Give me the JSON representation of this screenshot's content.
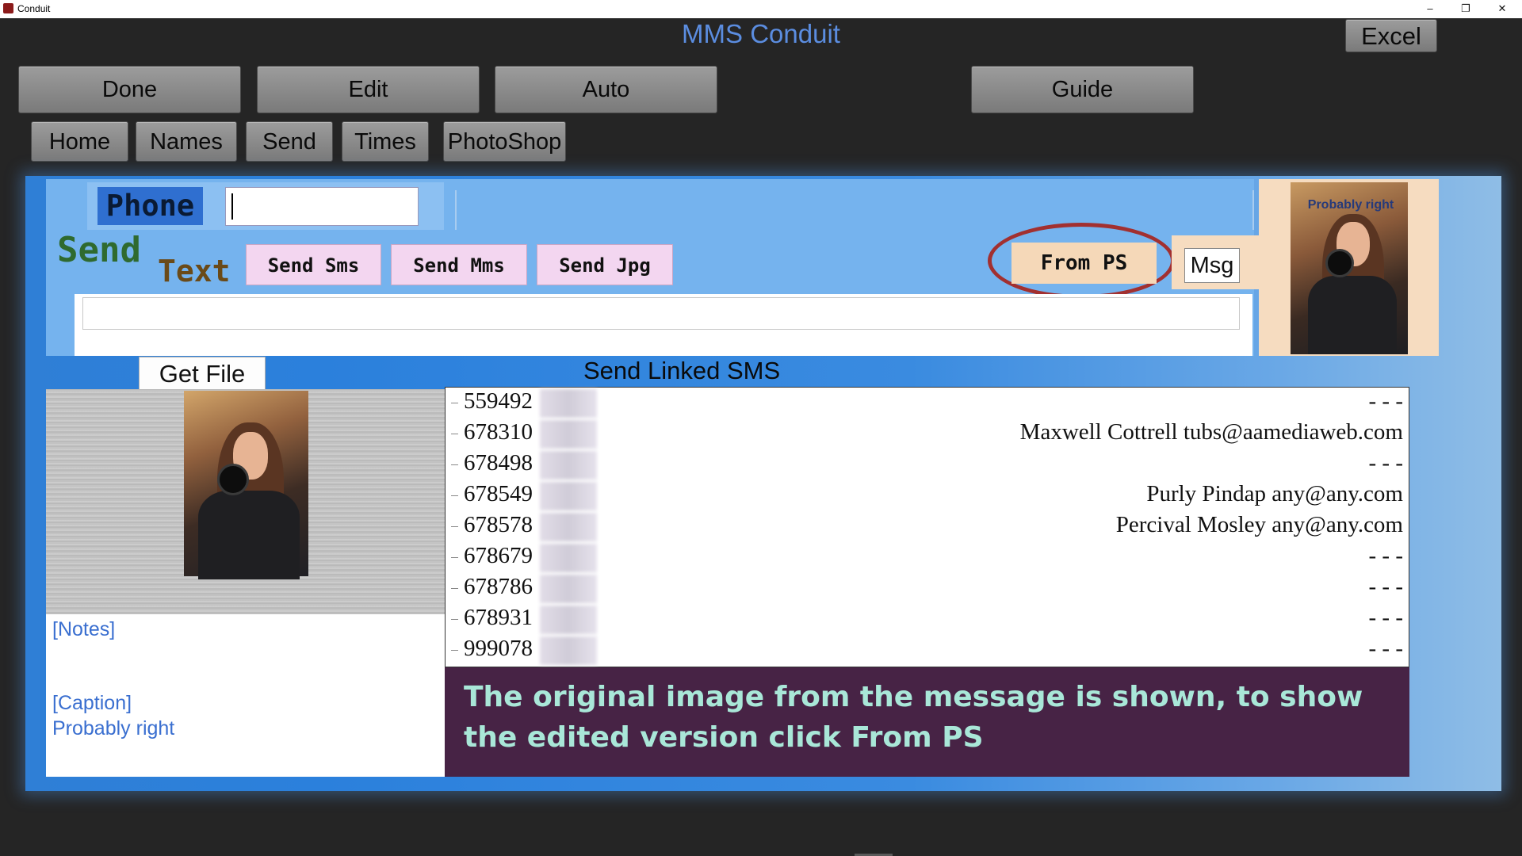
{
  "window": {
    "title": "Conduit",
    "controls": {
      "minimize": "–",
      "maximize": "❐",
      "close": "✕"
    }
  },
  "app": {
    "title": "MMS Conduit",
    "accent_color": "#5b8de0"
  },
  "toolbar": {
    "excel": "Excel",
    "done": "Done",
    "edit": "Edit",
    "auto": "Auto",
    "guide": "Guide"
  },
  "nav": {
    "home": "Home",
    "names": "Names",
    "send": "Send",
    "times": "Times",
    "photoshop": "PhotoShop"
  },
  "send_panel": {
    "phone_label": "Phone",
    "phone_value": "",
    "send_label": "Send",
    "text_label": "Text",
    "send_sms": "Send Sms",
    "send_mms": "Send Mms",
    "send_jpg": "Send Jpg",
    "from_ps": "From PS",
    "msg": "Msg",
    "message_value": "",
    "thumbnail_caption": "Probably right"
  },
  "file": {
    "get_file": "Get File",
    "notes": "[Notes]",
    "caption_label": "[Caption]",
    "caption_value": "Probably right"
  },
  "list": {
    "title": "Send Linked SMS",
    "rows": [
      {
        "phone": "559492",
        "contact": "- - -"
      },
      {
        "phone": "678310",
        "contact": "Maxwell Cottrell tubs@aamediaweb.com"
      },
      {
        "phone": "678498",
        "contact": "- - -"
      },
      {
        "phone": "678549",
        "contact": "Purly Pindap any@any.com"
      },
      {
        "phone": "678578",
        "contact": "Percival Mosley any@any.com"
      },
      {
        "phone": "678679",
        "contact": "- - -"
      },
      {
        "phone": "678786",
        "contact": "- - -"
      },
      {
        "phone": "678931",
        "contact": "- - -"
      },
      {
        "phone": "999078",
        "contact": "- - -"
      }
    ]
  },
  "info_message": "The original image from the message is shown, to show the edited version click From PS"
}
